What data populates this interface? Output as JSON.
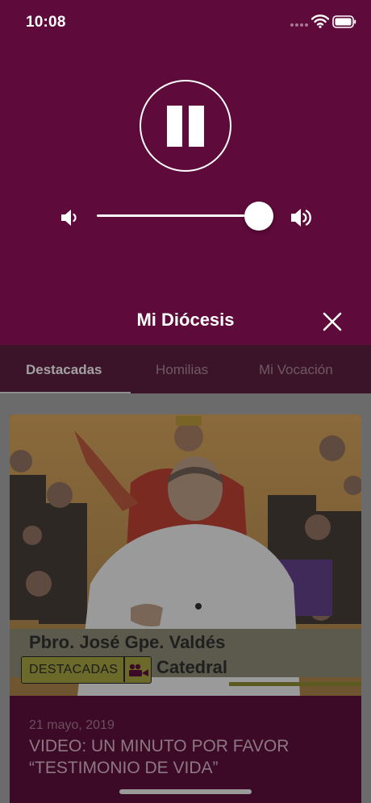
{
  "status_bar": {
    "time": "10:08"
  },
  "player": {
    "title": "Mi Diócesis",
    "state": "playing",
    "volume_level": 1.0
  },
  "tabs": [
    {
      "label": "Destacadas",
      "active": true
    },
    {
      "label": "Homilias",
      "active": false
    },
    {
      "label": "Mi Vocación",
      "active": false
    }
  ],
  "card": {
    "badge_label": "DESTACADAS",
    "badge_icon": "video-camera-icon",
    "video_caption_line1": "Pbro. José Gpe. Valdés",
    "video_caption_line2": "Catedral",
    "date": "21 mayo, 2019",
    "title_line1": "VIDEO: UN MINUTO POR FAVOR",
    "title_line2": "“TESTIMONIO DE VIDA”"
  },
  "colors": {
    "player_bg": "#5e0a3a",
    "tab_bar_bg": "#3c1429",
    "card_bg": "#3c0a26",
    "badge_bg": "#6b6a2b"
  }
}
